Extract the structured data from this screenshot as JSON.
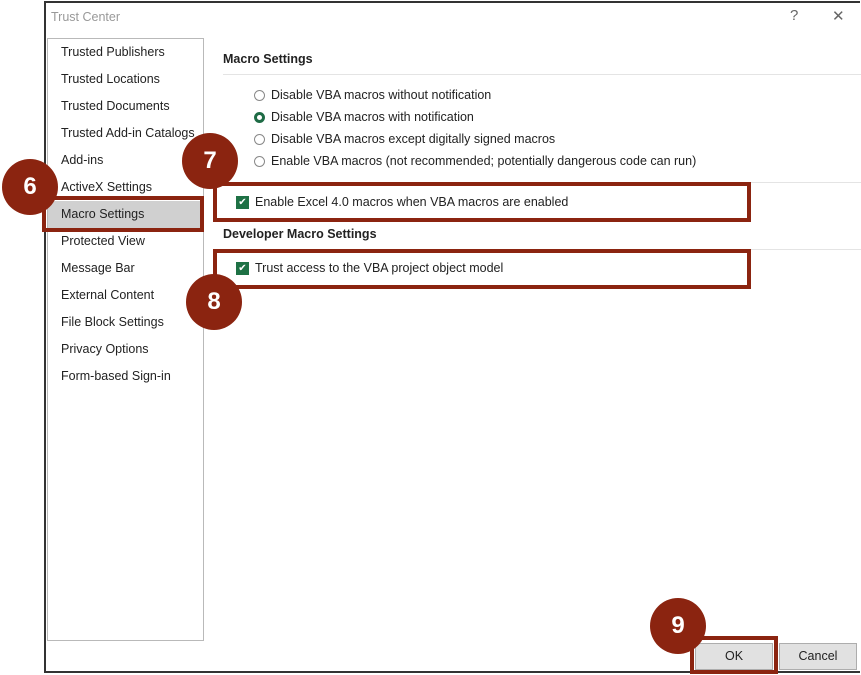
{
  "window": {
    "title": "Trust Center",
    "help": "?",
    "close": "✕"
  },
  "sidebar": {
    "items": [
      {
        "label": "Trusted Publishers"
      },
      {
        "label": "Trusted Locations"
      },
      {
        "label": "Trusted Documents"
      },
      {
        "label": "Trusted Add-in Catalogs"
      },
      {
        "label": "Add-ins"
      },
      {
        "label": "ActiveX Settings"
      },
      {
        "label": "Macro Settings",
        "selected": true
      },
      {
        "label": "Protected View"
      },
      {
        "label": "Message Bar"
      },
      {
        "label": "External Content"
      },
      {
        "label": "File Block Settings"
      },
      {
        "label": "Privacy Options"
      },
      {
        "label": "Form-based Sign-in"
      }
    ]
  },
  "main": {
    "macro_heading": "Macro Settings",
    "radios": [
      {
        "label": "Disable VBA macros without notification",
        "checked": false
      },
      {
        "label": "Disable VBA macros with notification",
        "checked": true
      },
      {
        "label": "Disable VBA macros except digitally signed macros",
        "checked": false
      },
      {
        "label": "Enable VBA macros (not recommended; potentially dangerous code can run)",
        "checked": false
      }
    ],
    "excel4": {
      "label": "Enable Excel 4.0 macros when VBA macros are enabled",
      "checked": true
    },
    "dev_heading": "Developer Macro Settings",
    "vba_trust": {
      "label": "Trust access to the VBA project object model",
      "checked": true
    }
  },
  "buttons": {
    "ok": "OK",
    "cancel": "Cancel"
  },
  "annotations": {
    "step6": "6",
    "step7": "7",
    "step8": "8",
    "step9": "9"
  },
  "colors": {
    "annotation": "#8b2410",
    "check": "#1e7145"
  }
}
